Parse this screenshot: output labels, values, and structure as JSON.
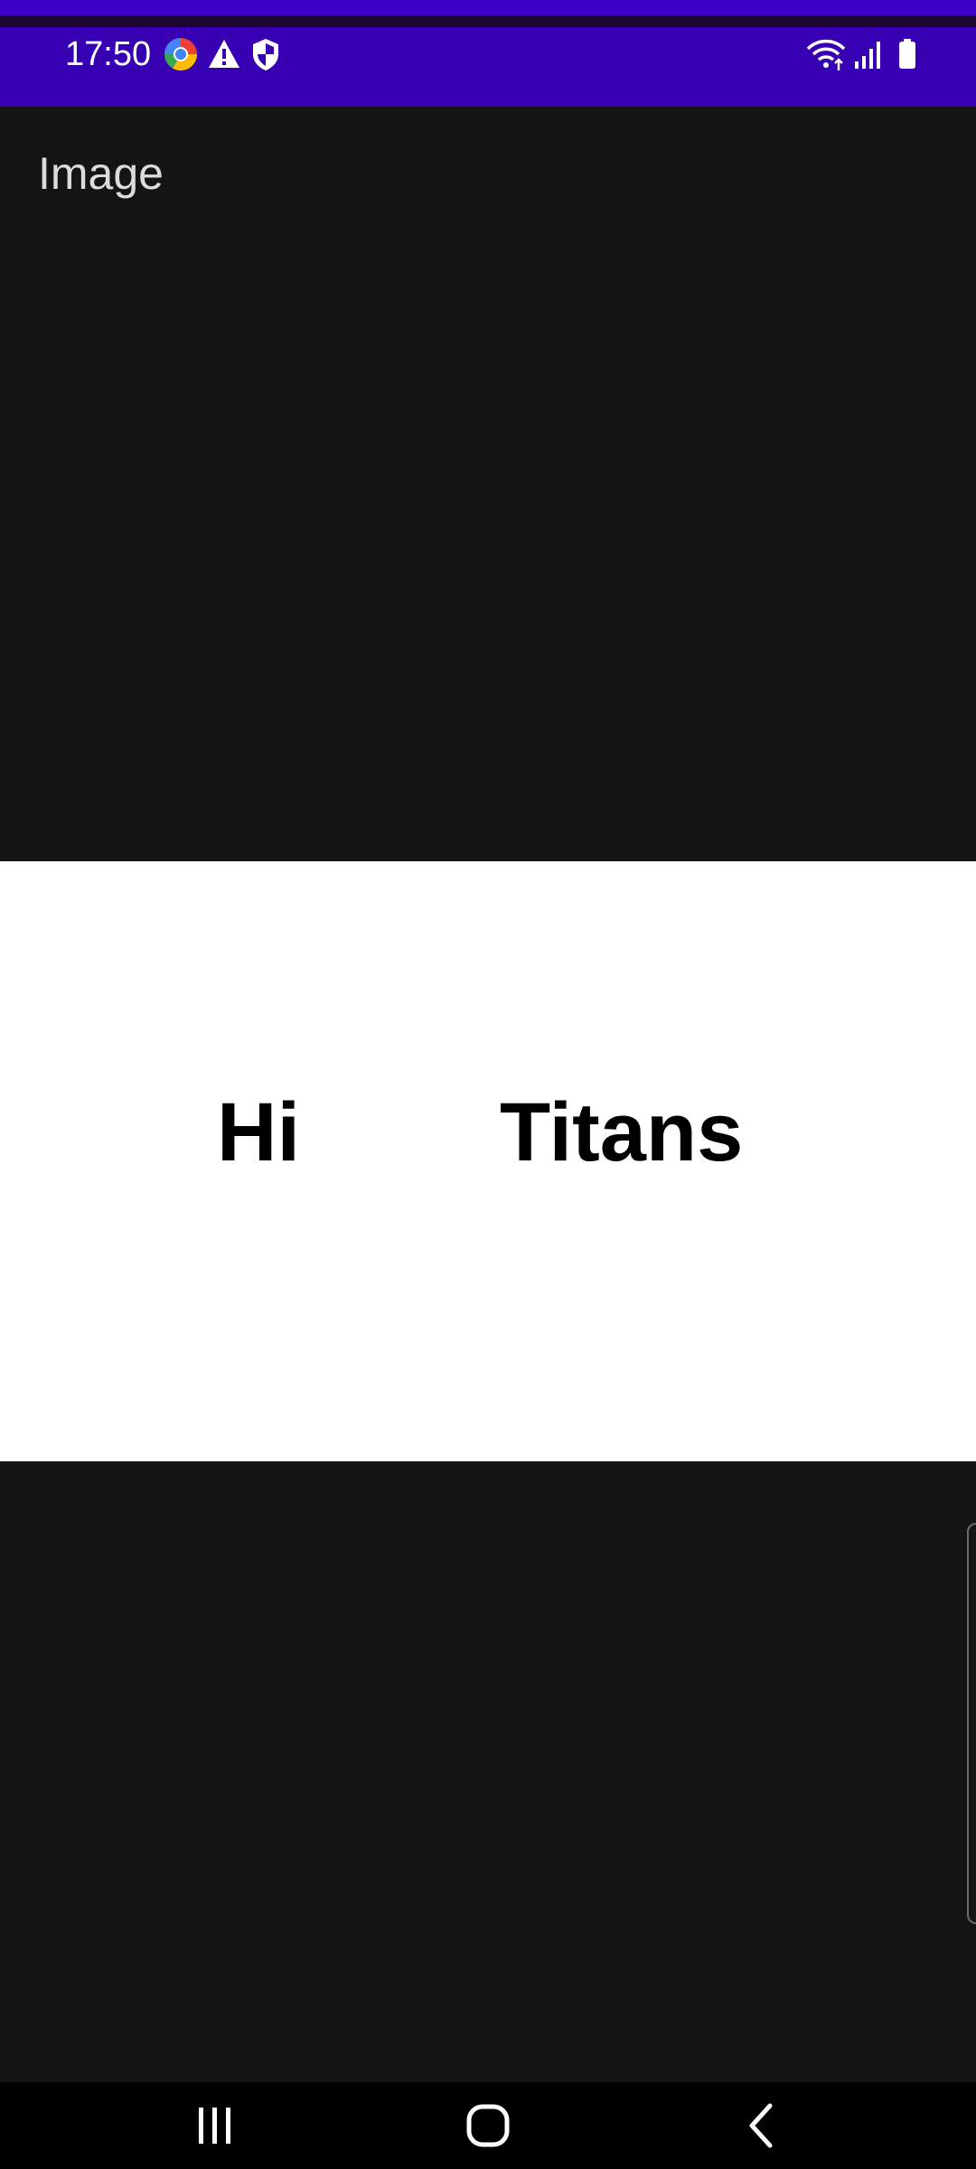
{
  "status_bar": {
    "time": "17:50",
    "left_icons": [
      "chrome-icon",
      "warning-icon",
      "shield-icon"
    ],
    "right_icons": [
      "wifi-icon",
      "signal-icon",
      "battery-icon"
    ],
    "bg_color": "#3700b3"
  },
  "header": {
    "title": "Image"
  },
  "image_panel": {
    "words": [
      "Hi",
      "Titans"
    ]
  },
  "navigation_bar": {
    "buttons": [
      "recent-apps-icon",
      "home-icon",
      "back-icon"
    ]
  }
}
